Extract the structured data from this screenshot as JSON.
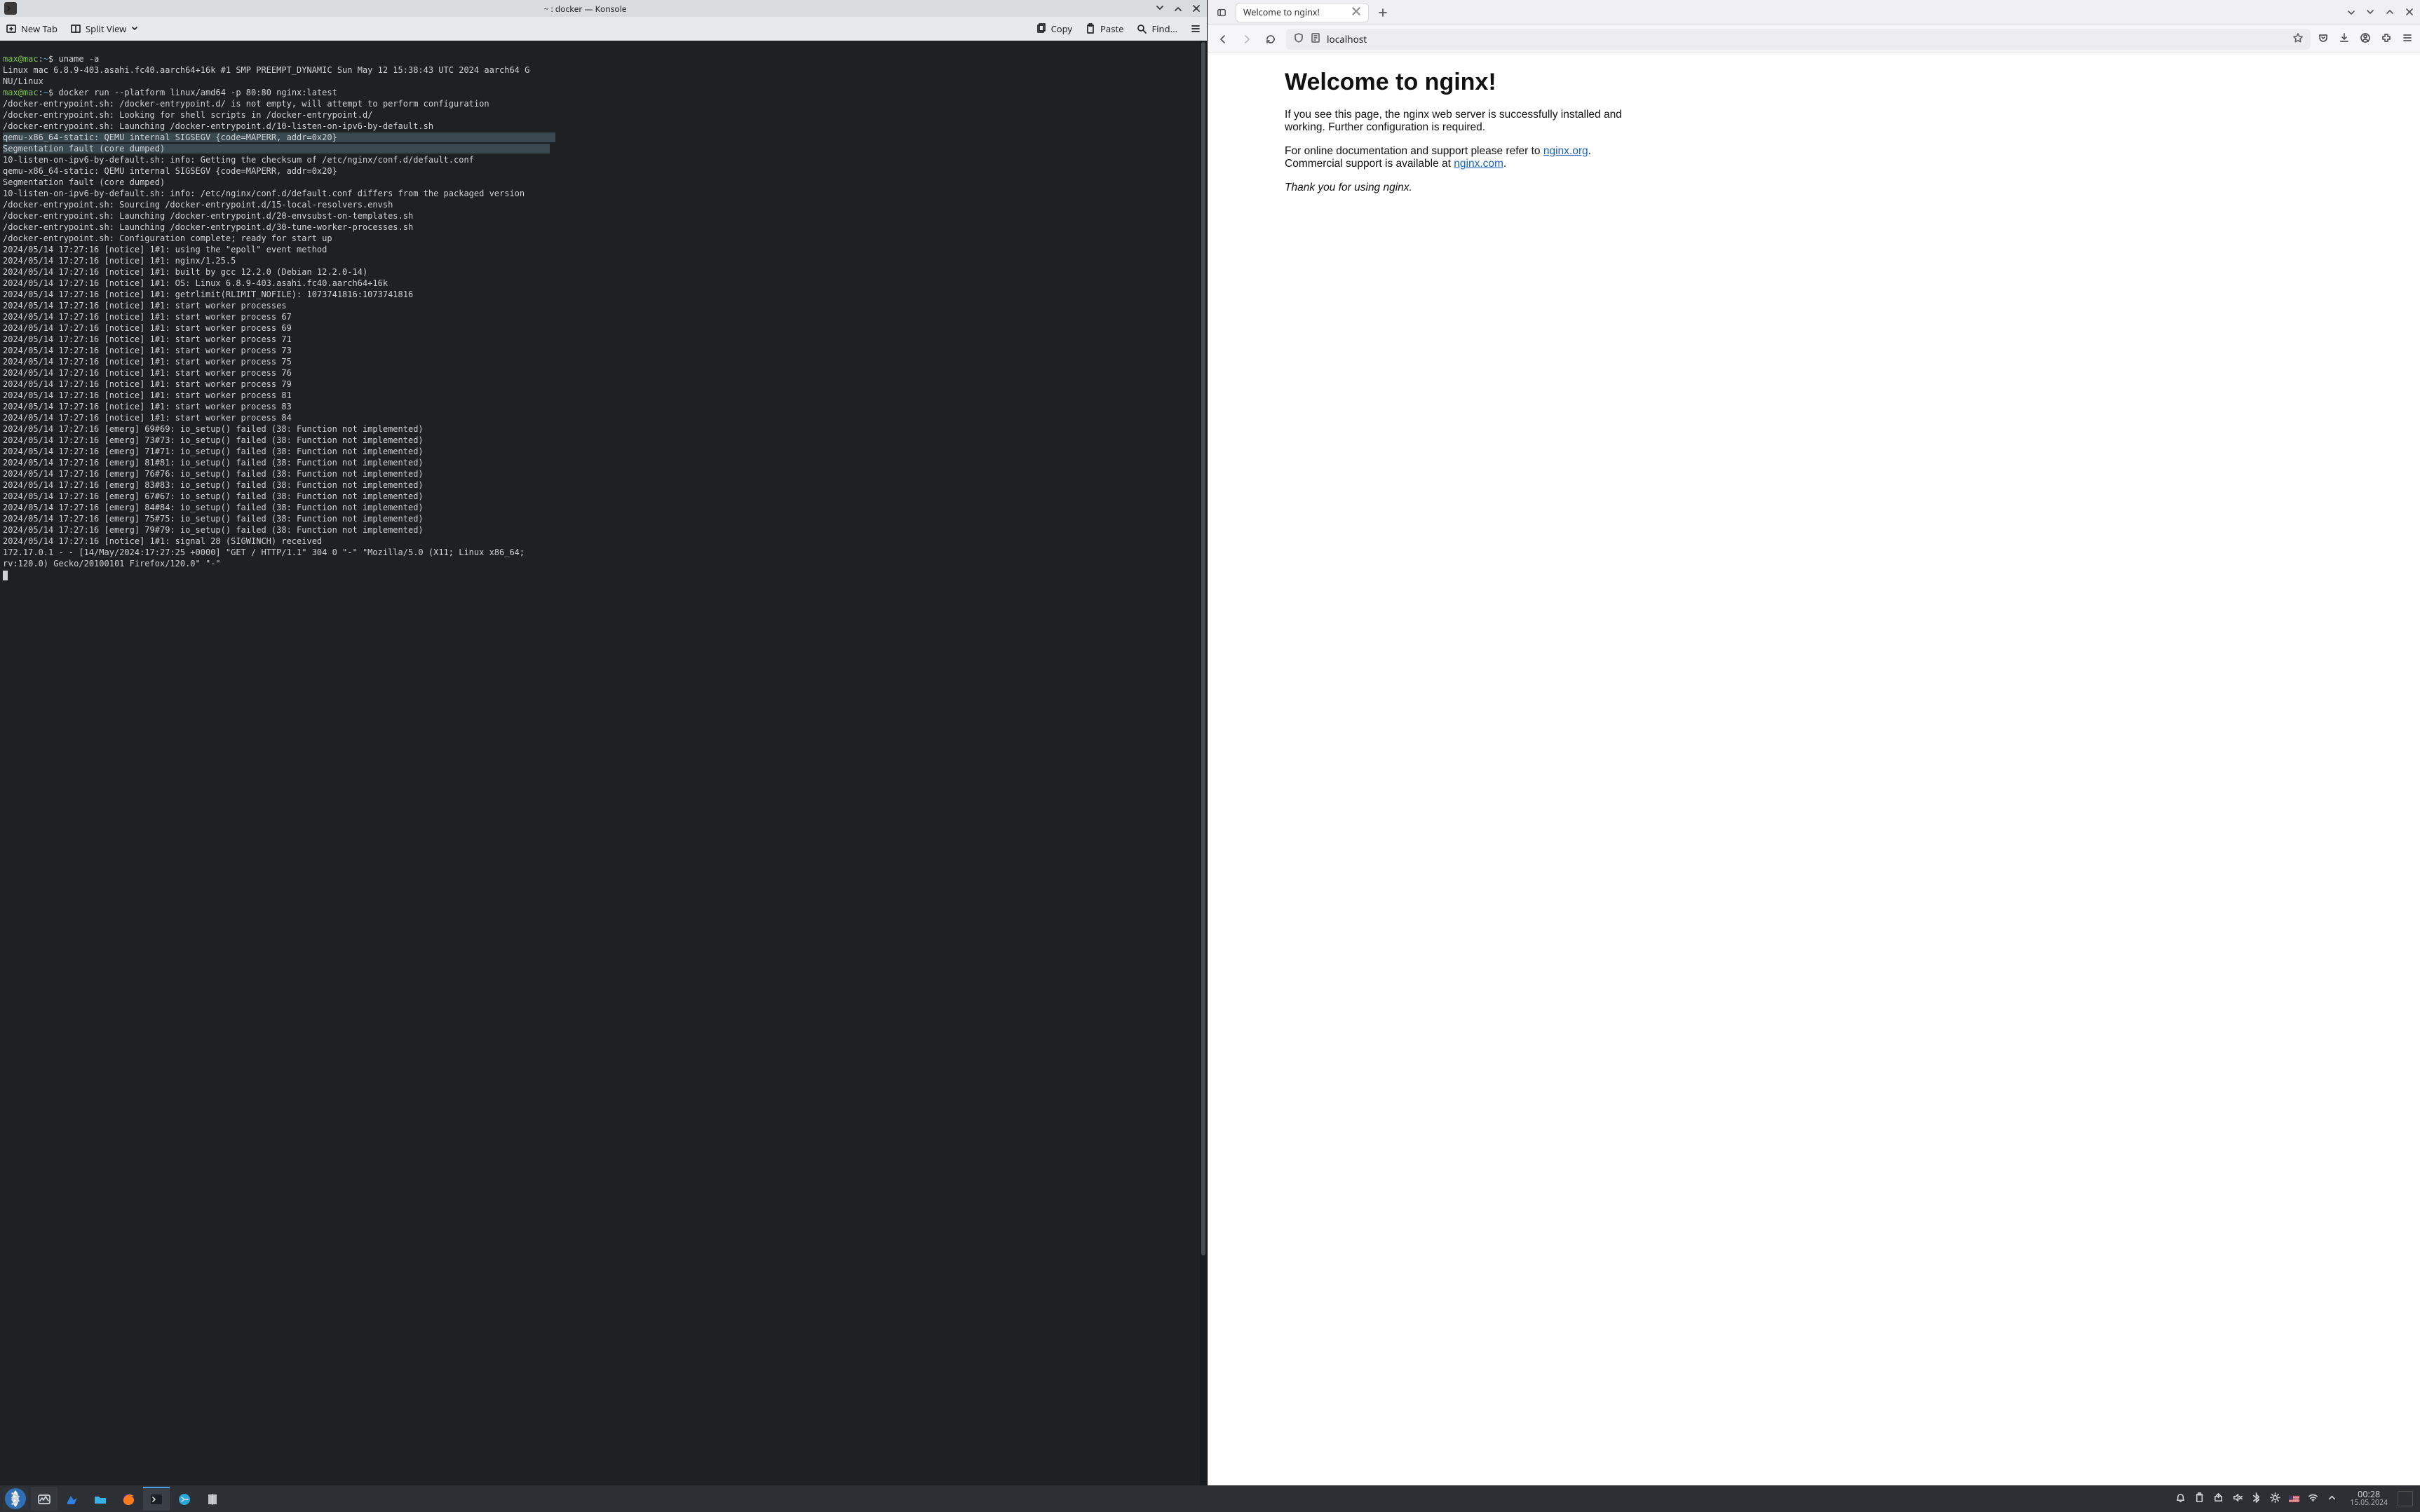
{
  "konsole": {
    "title": "~ : docker — Konsole",
    "toolbar": {
      "new_tab": "New Tab",
      "split_view": "Split View",
      "copy": "Copy",
      "paste": "Paste",
      "find": "Find..."
    },
    "prompt_user": "max@mac",
    "prompt_path": "~",
    "cmds": {
      "uname": "uname -a",
      "docker": "docker run --platform linux/amd64 -p 80:80 nginx:latest"
    },
    "output": {
      "uname_out1": "Linux mac 6.8.9-403.asahi.fc40.aarch64+16k #1 SMP PREEMPT_DYNAMIC Sun May 12 15:38:43 UTC 2024 aarch64 G",
      "uname_out2": "NU/Linux",
      "l1": "/docker-entrypoint.sh: /docker-entrypoint.d/ is not empty, will attempt to perform configuration",
      "l2": "/docker-entrypoint.sh: Looking for shell scripts in /docker-entrypoint.d/",
      "l3": "/docker-entrypoint.sh: Launching /docker-entrypoint.d/10-listen-on-ipv6-by-default.sh",
      "sel1": "qemu-x86_64-static: QEMU internal SIGSEGV {code=MAPERR, addr=0x20}",
      "sel2": "Segmentation fault (core dumped)",
      "l4": "10-listen-on-ipv6-by-default.sh: info: Getting the checksum of /etc/nginx/conf.d/default.conf",
      "l5": "qemu-x86_64-static: QEMU internal SIGSEGV {code=MAPERR, addr=0x20}",
      "l6": "Segmentation fault (core dumped)",
      "l7": "10-listen-on-ipv6-by-default.sh: info: /etc/nginx/conf.d/default.conf differs from the packaged version",
      "l8": "/docker-entrypoint.sh: Sourcing /docker-entrypoint.d/15-local-resolvers.envsh",
      "l9": "/docker-entrypoint.sh: Launching /docker-entrypoint.d/20-envsubst-on-templates.sh",
      "l10": "/docker-entrypoint.sh: Launching /docker-entrypoint.d/30-tune-worker-processes.sh",
      "l11": "/docker-entrypoint.sh: Configuration complete; ready for start up",
      "n1": "2024/05/14 17:27:16 [notice] 1#1: using the \"epoll\" event method",
      "n2": "2024/05/14 17:27:16 [notice] 1#1: nginx/1.25.5",
      "n3": "2024/05/14 17:27:16 [notice] 1#1: built by gcc 12.2.0 (Debian 12.2.0-14)",
      "n4": "2024/05/14 17:27:16 [notice] 1#1: OS: Linux 6.8.9-403.asahi.fc40.aarch64+16k",
      "n5": "2024/05/14 17:27:16 [notice] 1#1: getrlimit(RLIMIT_NOFILE): 1073741816:1073741816",
      "n6": "2024/05/14 17:27:16 [notice] 1#1: start worker processes",
      "n7": "2024/05/14 17:27:16 [notice] 1#1: start worker process 67",
      "n8": "2024/05/14 17:27:16 [notice] 1#1: start worker process 69",
      "n9": "2024/05/14 17:27:16 [notice] 1#1: start worker process 71",
      "n10": "2024/05/14 17:27:16 [notice] 1#1: start worker process 73",
      "n11": "2024/05/14 17:27:16 [notice] 1#1: start worker process 75",
      "n12": "2024/05/14 17:27:16 [notice] 1#1: start worker process 76",
      "n13": "2024/05/14 17:27:16 [notice] 1#1: start worker process 79",
      "n14": "2024/05/14 17:27:16 [notice] 1#1: start worker process 81",
      "n15": "2024/05/14 17:27:16 [notice] 1#1: start worker process 83",
      "n16": "2024/05/14 17:27:16 [notice] 1#1: start worker process 84",
      "e1": "2024/05/14 17:27:16 [emerg] 69#69: io_setup() failed (38: Function not implemented)",
      "e2": "2024/05/14 17:27:16 [emerg] 73#73: io_setup() failed (38: Function not implemented)",
      "e3": "2024/05/14 17:27:16 [emerg] 71#71: io_setup() failed (38: Function not implemented)",
      "e4": "2024/05/14 17:27:16 [emerg] 81#81: io_setup() failed (38: Function not implemented)",
      "e5": "2024/05/14 17:27:16 [emerg] 76#76: io_setup() failed (38: Function not implemented)",
      "e6": "2024/05/14 17:27:16 [emerg] 83#83: io_setup() failed (38: Function not implemented)",
      "e7": "2024/05/14 17:27:16 [emerg] 67#67: io_setup() failed (38: Function not implemented)",
      "e8": "2024/05/14 17:27:16 [emerg] 84#84: io_setup() failed (38: Function not implemented)",
      "e9": "2024/05/14 17:27:16 [emerg] 75#75: io_setup() failed (38: Function not implemented)",
      "e10": "2024/05/14 17:27:16 [emerg] 79#79: io_setup() failed (38: Function not implemented)",
      "n17": "2024/05/14 17:27:16 [notice] 1#1: signal 28 (SIGWINCH) received",
      "req1": "172.17.0.1 - - [14/May/2024:17:27:25 +0000] \"GET / HTTP/1.1\" 304 0 \"-\" \"Mozilla/5.0 (X11; Linux x86_64;",
      "req2": "rv:120.0) Gecko/20100101 Firefox/120.0\" \"-\""
    }
  },
  "browser": {
    "tab_title": "Welcome to nginx!",
    "url": "localhost",
    "page": {
      "h1": "Welcome to nginx!",
      "p1": "If you see this page, the nginx web server is successfully installed and working. Further configuration is required.",
      "p2a": "For online documentation and support please refer to ",
      "link1": "nginx.org",
      "p2b": ".",
      "p2c": "Commercial support is available at ",
      "link2": "nginx.com",
      "p2d": ".",
      "thanks": "Thank you for using nginx."
    }
  },
  "taskbar": {
    "clock_time": "00:28",
    "clock_date": "15.05.2024"
  }
}
